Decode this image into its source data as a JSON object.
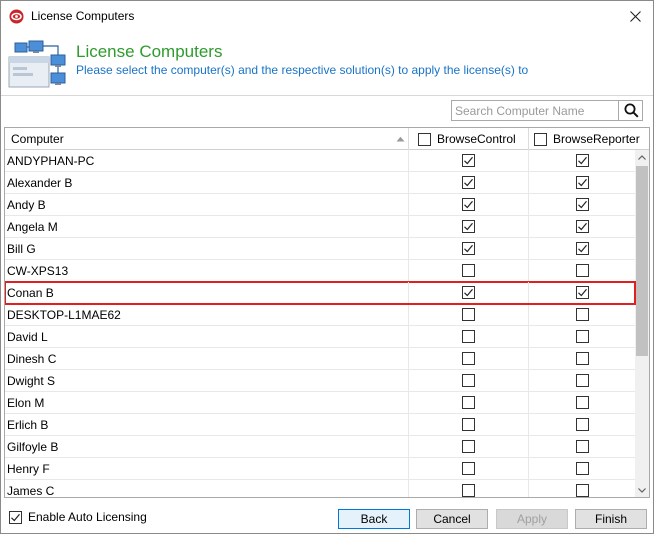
{
  "window": {
    "title": "License Computers"
  },
  "header": {
    "title": "License Computers",
    "subtitle": "Please select the computer(s) and the respective solution(s) to apply the license(s) to"
  },
  "search": {
    "placeholder": "Search Computer Name",
    "value": ""
  },
  "grid": {
    "columns": [
      {
        "label": "Computer",
        "sorted": "ascending"
      },
      {
        "label": "BrowseControl",
        "checked": false
      },
      {
        "label": "BrowseReporter",
        "checked": false
      }
    ],
    "rows": [
      {
        "name": "ANDYPHAN-PC",
        "browse_control": true,
        "browse_reporter": true,
        "selected": false
      },
      {
        "name": "Alexander B",
        "browse_control": true,
        "browse_reporter": true,
        "selected": false
      },
      {
        "name": "Andy B",
        "browse_control": true,
        "browse_reporter": true,
        "selected": false
      },
      {
        "name": "Angela M",
        "browse_control": true,
        "browse_reporter": true,
        "selected": false
      },
      {
        "name": "Bill G",
        "browse_control": true,
        "browse_reporter": true,
        "selected": false
      },
      {
        "name": "CW-XPS13",
        "browse_control": false,
        "browse_reporter": false,
        "selected": false
      },
      {
        "name": "Conan B",
        "browse_control": true,
        "browse_reporter": true,
        "selected": true
      },
      {
        "name": "DESKTOP-L1MAE62",
        "browse_control": false,
        "browse_reporter": false,
        "selected": false
      },
      {
        "name": "David L",
        "browse_control": false,
        "browse_reporter": false,
        "selected": false
      },
      {
        "name": "Dinesh C",
        "browse_control": false,
        "browse_reporter": false,
        "selected": false
      },
      {
        "name": "Dwight S",
        "browse_control": false,
        "browse_reporter": false,
        "selected": false
      },
      {
        "name": "Elon M",
        "browse_control": false,
        "browse_reporter": false,
        "selected": false
      },
      {
        "name": "Erlich B",
        "browse_control": false,
        "browse_reporter": false,
        "selected": false
      },
      {
        "name": "Gilfoyle B",
        "browse_control": false,
        "browse_reporter": false,
        "selected": false
      },
      {
        "name": "Henry F",
        "browse_control": false,
        "browse_reporter": false,
        "selected": false
      },
      {
        "name": "James C",
        "browse_control": false,
        "browse_reporter": false,
        "selected": false
      }
    ]
  },
  "footer": {
    "auto_licensing_label": "Enable Auto Licensing",
    "auto_licensing_checked": true,
    "buttons": {
      "back": "Back",
      "cancel": "Cancel",
      "apply": "Apply",
      "finish": "Finish"
    }
  },
  "colors": {
    "header_title": "#2e9b2e",
    "header_subtitle": "#1a73c8",
    "selection_outline": "#e02020",
    "default_button_border": "#0078d7"
  },
  "icons": {
    "app": "app-logo-icon",
    "close": "close-icon",
    "header": "network-computers-icon",
    "search": "search-icon",
    "sort": "sort-up-icon",
    "check": "check-icon"
  }
}
